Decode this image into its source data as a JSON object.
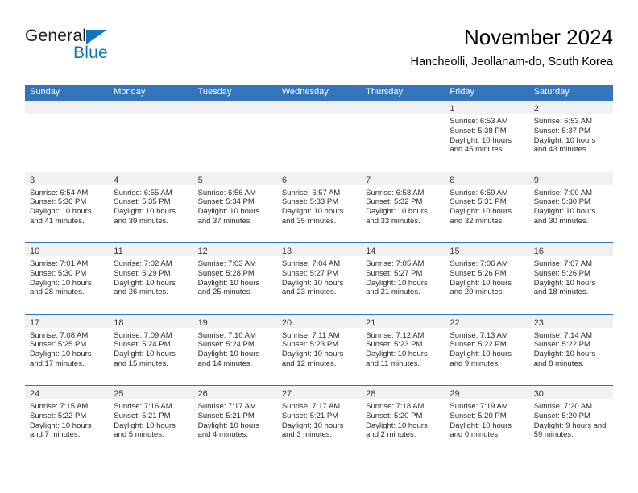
{
  "brand": {
    "name_top": "General",
    "name_bottom": "Blue",
    "accent_color": "#1275bc"
  },
  "header": {
    "title": "November 2024",
    "subtitle": "Hancheolli, Jeollanam-do, South Korea"
  },
  "theme": {
    "header_blue": "#3275bb",
    "daynum_band": "#f1f1f1"
  },
  "weekdays": [
    "Sunday",
    "Monday",
    "Tuesday",
    "Wednesday",
    "Thursday",
    "Friday",
    "Saturday"
  ],
  "weeks": [
    [
      {
        "day": ""
      },
      {
        "day": ""
      },
      {
        "day": ""
      },
      {
        "day": ""
      },
      {
        "day": ""
      },
      {
        "day": "1",
        "sunrise": "Sunrise: 6:53 AM",
        "sunset": "Sunset: 5:38 PM",
        "daylight": "Daylight: 10 hours and 45 minutes."
      },
      {
        "day": "2",
        "sunrise": "Sunrise: 6:53 AM",
        "sunset": "Sunset: 5:37 PM",
        "daylight": "Daylight: 10 hours and 43 minutes."
      }
    ],
    [
      {
        "day": "3",
        "sunrise": "Sunrise: 6:54 AM",
        "sunset": "Sunset: 5:36 PM",
        "daylight": "Daylight: 10 hours and 41 minutes."
      },
      {
        "day": "4",
        "sunrise": "Sunrise: 6:55 AM",
        "sunset": "Sunset: 5:35 PM",
        "daylight": "Daylight: 10 hours and 39 minutes."
      },
      {
        "day": "5",
        "sunrise": "Sunrise: 6:56 AM",
        "sunset": "Sunset: 5:34 PM",
        "daylight": "Daylight: 10 hours and 37 minutes."
      },
      {
        "day": "6",
        "sunrise": "Sunrise: 6:57 AM",
        "sunset": "Sunset: 5:33 PM",
        "daylight": "Daylight: 10 hours and 35 minutes."
      },
      {
        "day": "7",
        "sunrise": "Sunrise: 6:58 AM",
        "sunset": "Sunset: 5:32 PM",
        "daylight": "Daylight: 10 hours and 33 minutes."
      },
      {
        "day": "8",
        "sunrise": "Sunrise: 6:59 AM",
        "sunset": "Sunset: 5:31 PM",
        "daylight": "Daylight: 10 hours and 32 minutes."
      },
      {
        "day": "9",
        "sunrise": "Sunrise: 7:00 AM",
        "sunset": "Sunset: 5:30 PM",
        "daylight": "Daylight: 10 hours and 30 minutes."
      }
    ],
    [
      {
        "day": "10",
        "sunrise": "Sunrise: 7:01 AM",
        "sunset": "Sunset: 5:30 PM",
        "daylight": "Daylight: 10 hours and 28 minutes."
      },
      {
        "day": "11",
        "sunrise": "Sunrise: 7:02 AM",
        "sunset": "Sunset: 5:29 PM",
        "daylight": "Daylight: 10 hours and 26 minutes."
      },
      {
        "day": "12",
        "sunrise": "Sunrise: 7:03 AM",
        "sunset": "Sunset: 5:28 PM",
        "daylight": "Daylight: 10 hours and 25 minutes."
      },
      {
        "day": "13",
        "sunrise": "Sunrise: 7:04 AM",
        "sunset": "Sunset: 5:27 PM",
        "daylight": "Daylight: 10 hours and 23 minutes."
      },
      {
        "day": "14",
        "sunrise": "Sunrise: 7:05 AM",
        "sunset": "Sunset: 5:27 PM",
        "daylight": "Daylight: 10 hours and 21 minutes."
      },
      {
        "day": "15",
        "sunrise": "Sunrise: 7:06 AM",
        "sunset": "Sunset: 5:26 PM",
        "daylight": "Daylight: 10 hours and 20 minutes."
      },
      {
        "day": "16",
        "sunrise": "Sunrise: 7:07 AM",
        "sunset": "Sunset: 5:26 PM",
        "daylight": "Daylight: 10 hours and 18 minutes."
      }
    ],
    [
      {
        "day": "17",
        "sunrise": "Sunrise: 7:08 AM",
        "sunset": "Sunset: 5:25 PM",
        "daylight": "Daylight: 10 hours and 17 minutes."
      },
      {
        "day": "18",
        "sunrise": "Sunrise: 7:09 AM",
        "sunset": "Sunset: 5:24 PM",
        "daylight": "Daylight: 10 hours and 15 minutes."
      },
      {
        "day": "19",
        "sunrise": "Sunrise: 7:10 AM",
        "sunset": "Sunset: 5:24 PM",
        "daylight": "Daylight: 10 hours and 14 minutes."
      },
      {
        "day": "20",
        "sunrise": "Sunrise: 7:11 AM",
        "sunset": "Sunset: 5:23 PM",
        "daylight": "Daylight: 10 hours and 12 minutes."
      },
      {
        "day": "21",
        "sunrise": "Sunrise: 7:12 AM",
        "sunset": "Sunset: 5:23 PM",
        "daylight": "Daylight: 10 hours and 11 minutes."
      },
      {
        "day": "22",
        "sunrise": "Sunrise: 7:13 AM",
        "sunset": "Sunset: 5:22 PM",
        "daylight": "Daylight: 10 hours and 9 minutes."
      },
      {
        "day": "23",
        "sunrise": "Sunrise: 7:14 AM",
        "sunset": "Sunset: 5:22 PM",
        "daylight": "Daylight: 10 hours and 8 minutes."
      }
    ],
    [
      {
        "day": "24",
        "sunrise": "Sunrise: 7:15 AM",
        "sunset": "Sunset: 5:22 PM",
        "daylight": "Daylight: 10 hours and 7 minutes."
      },
      {
        "day": "25",
        "sunrise": "Sunrise: 7:16 AM",
        "sunset": "Sunset: 5:21 PM",
        "daylight": "Daylight: 10 hours and 5 minutes."
      },
      {
        "day": "26",
        "sunrise": "Sunrise: 7:17 AM",
        "sunset": "Sunset: 5:21 PM",
        "daylight": "Daylight: 10 hours and 4 minutes."
      },
      {
        "day": "27",
        "sunrise": "Sunrise: 7:17 AM",
        "sunset": "Sunset: 5:21 PM",
        "daylight": "Daylight: 10 hours and 3 minutes."
      },
      {
        "day": "28",
        "sunrise": "Sunrise: 7:18 AM",
        "sunset": "Sunset: 5:20 PM",
        "daylight": "Daylight: 10 hours and 2 minutes."
      },
      {
        "day": "29",
        "sunrise": "Sunrise: 7:19 AM",
        "sunset": "Sunset: 5:20 PM",
        "daylight": "Daylight: 10 hours and 0 minutes."
      },
      {
        "day": "30",
        "sunrise": "Sunrise: 7:20 AM",
        "sunset": "Sunset: 5:20 PM",
        "daylight": "Daylight: 9 hours and 59 minutes."
      }
    ]
  ]
}
